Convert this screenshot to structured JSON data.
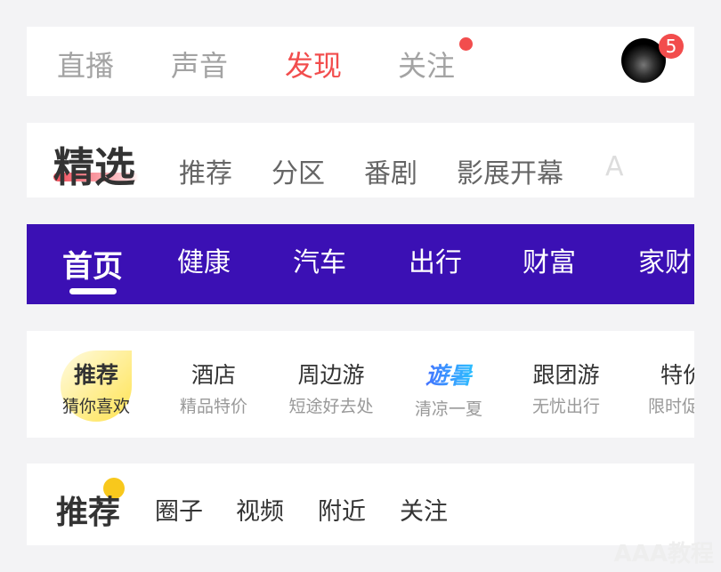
{
  "bar1": {
    "tabs": [
      "直播",
      "声音",
      "发现",
      "关注"
    ],
    "active": "发现",
    "badge_count": "5",
    "accent": "#f24d4d"
  },
  "bar2": {
    "tabs": [
      "精选",
      "推荐",
      "分区",
      "番剧",
      "影展开幕",
      "A"
    ],
    "active": "精选"
  },
  "bar3": {
    "tabs": [
      "首页",
      "健康",
      "汽车",
      "出行",
      "财富",
      "家财"
    ],
    "active": "首页",
    "background": "#3b10b4"
  },
  "bar4": {
    "items": [
      {
        "main": "推荐",
        "sub": "猜你喜欢"
      },
      {
        "main": "酒店",
        "sub": "精品特价"
      },
      {
        "main": "周边游",
        "sub": "短途好去处"
      },
      {
        "main": "遊暑",
        "sub": "清凉一夏"
      },
      {
        "main": "跟团游",
        "sub": "无忧出行"
      },
      {
        "main": "特价",
        "sub": "限时促"
      }
    ]
  },
  "bar5": {
    "tabs": [
      "推荐",
      "圈子",
      "视频",
      "附近",
      "关注"
    ],
    "active": "推荐"
  },
  "watermark": "AAA教程"
}
